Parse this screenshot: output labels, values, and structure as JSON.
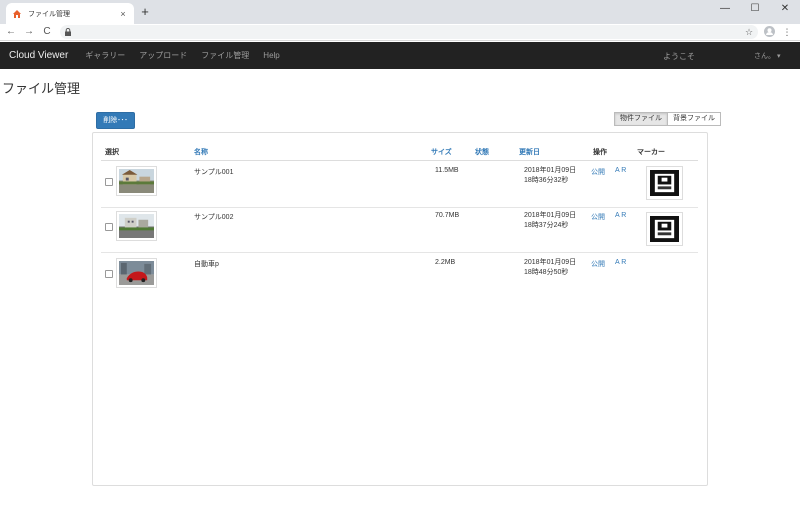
{
  "browser": {
    "tab_title": "ファイル管理",
    "close_glyph": "×",
    "new_tab_glyph": "+",
    "win_min": "—",
    "win_max": "☐",
    "win_close": "✕",
    "back_glyph": "←",
    "forward_glyph": "→",
    "reload_glyph": "C",
    "star_glyph": "☆",
    "menu_glyph": "⋮"
  },
  "navbar": {
    "brand": "Cloud Viewer",
    "links": [
      "ギャラリー",
      "アップロード",
      "ファイル管理",
      "Help"
    ],
    "welcome": "ようこそ",
    "user": "さん。 ▾"
  },
  "page": {
    "title": "ファイル管理",
    "delete_button": "削除･･･",
    "toggle": [
      "物件ファイル",
      "背景ファイル"
    ]
  },
  "table": {
    "headers": {
      "select": "選択",
      "name": "名称",
      "size": "サイズ",
      "status": "状態",
      "updated": "更新日",
      "action": "操作",
      "marker": "マーカー"
    },
    "rows": [
      {
        "name": "サンプル001",
        "size": "11.5MB",
        "date": "2018年01月09日",
        "time": "18時36分32秒",
        "publish": "公開",
        "ar": "A R",
        "has_marker": true
      },
      {
        "name": "サンプル002",
        "size": "70.7MB",
        "date": "2018年01月09日",
        "time": "18時37分24秒",
        "publish": "公開",
        "ar": "A R",
        "has_marker": true
      },
      {
        "name": "自動車p",
        "size": "2.2MB",
        "date": "2018年01月09日",
        "time": "18時48分50秒",
        "publish": "公開",
        "ar": "A R",
        "has_marker": false
      }
    ]
  },
  "icons": {
    "favicon": "house-icon",
    "lock": "lock-icon",
    "avatar": "account-icon",
    "marker": "ar-marker-icon"
  },
  "colors": {
    "navbar_bg": "#222222",
    "link": "#337ab7",
    "primary_button": "#337ab7"
  }
}
